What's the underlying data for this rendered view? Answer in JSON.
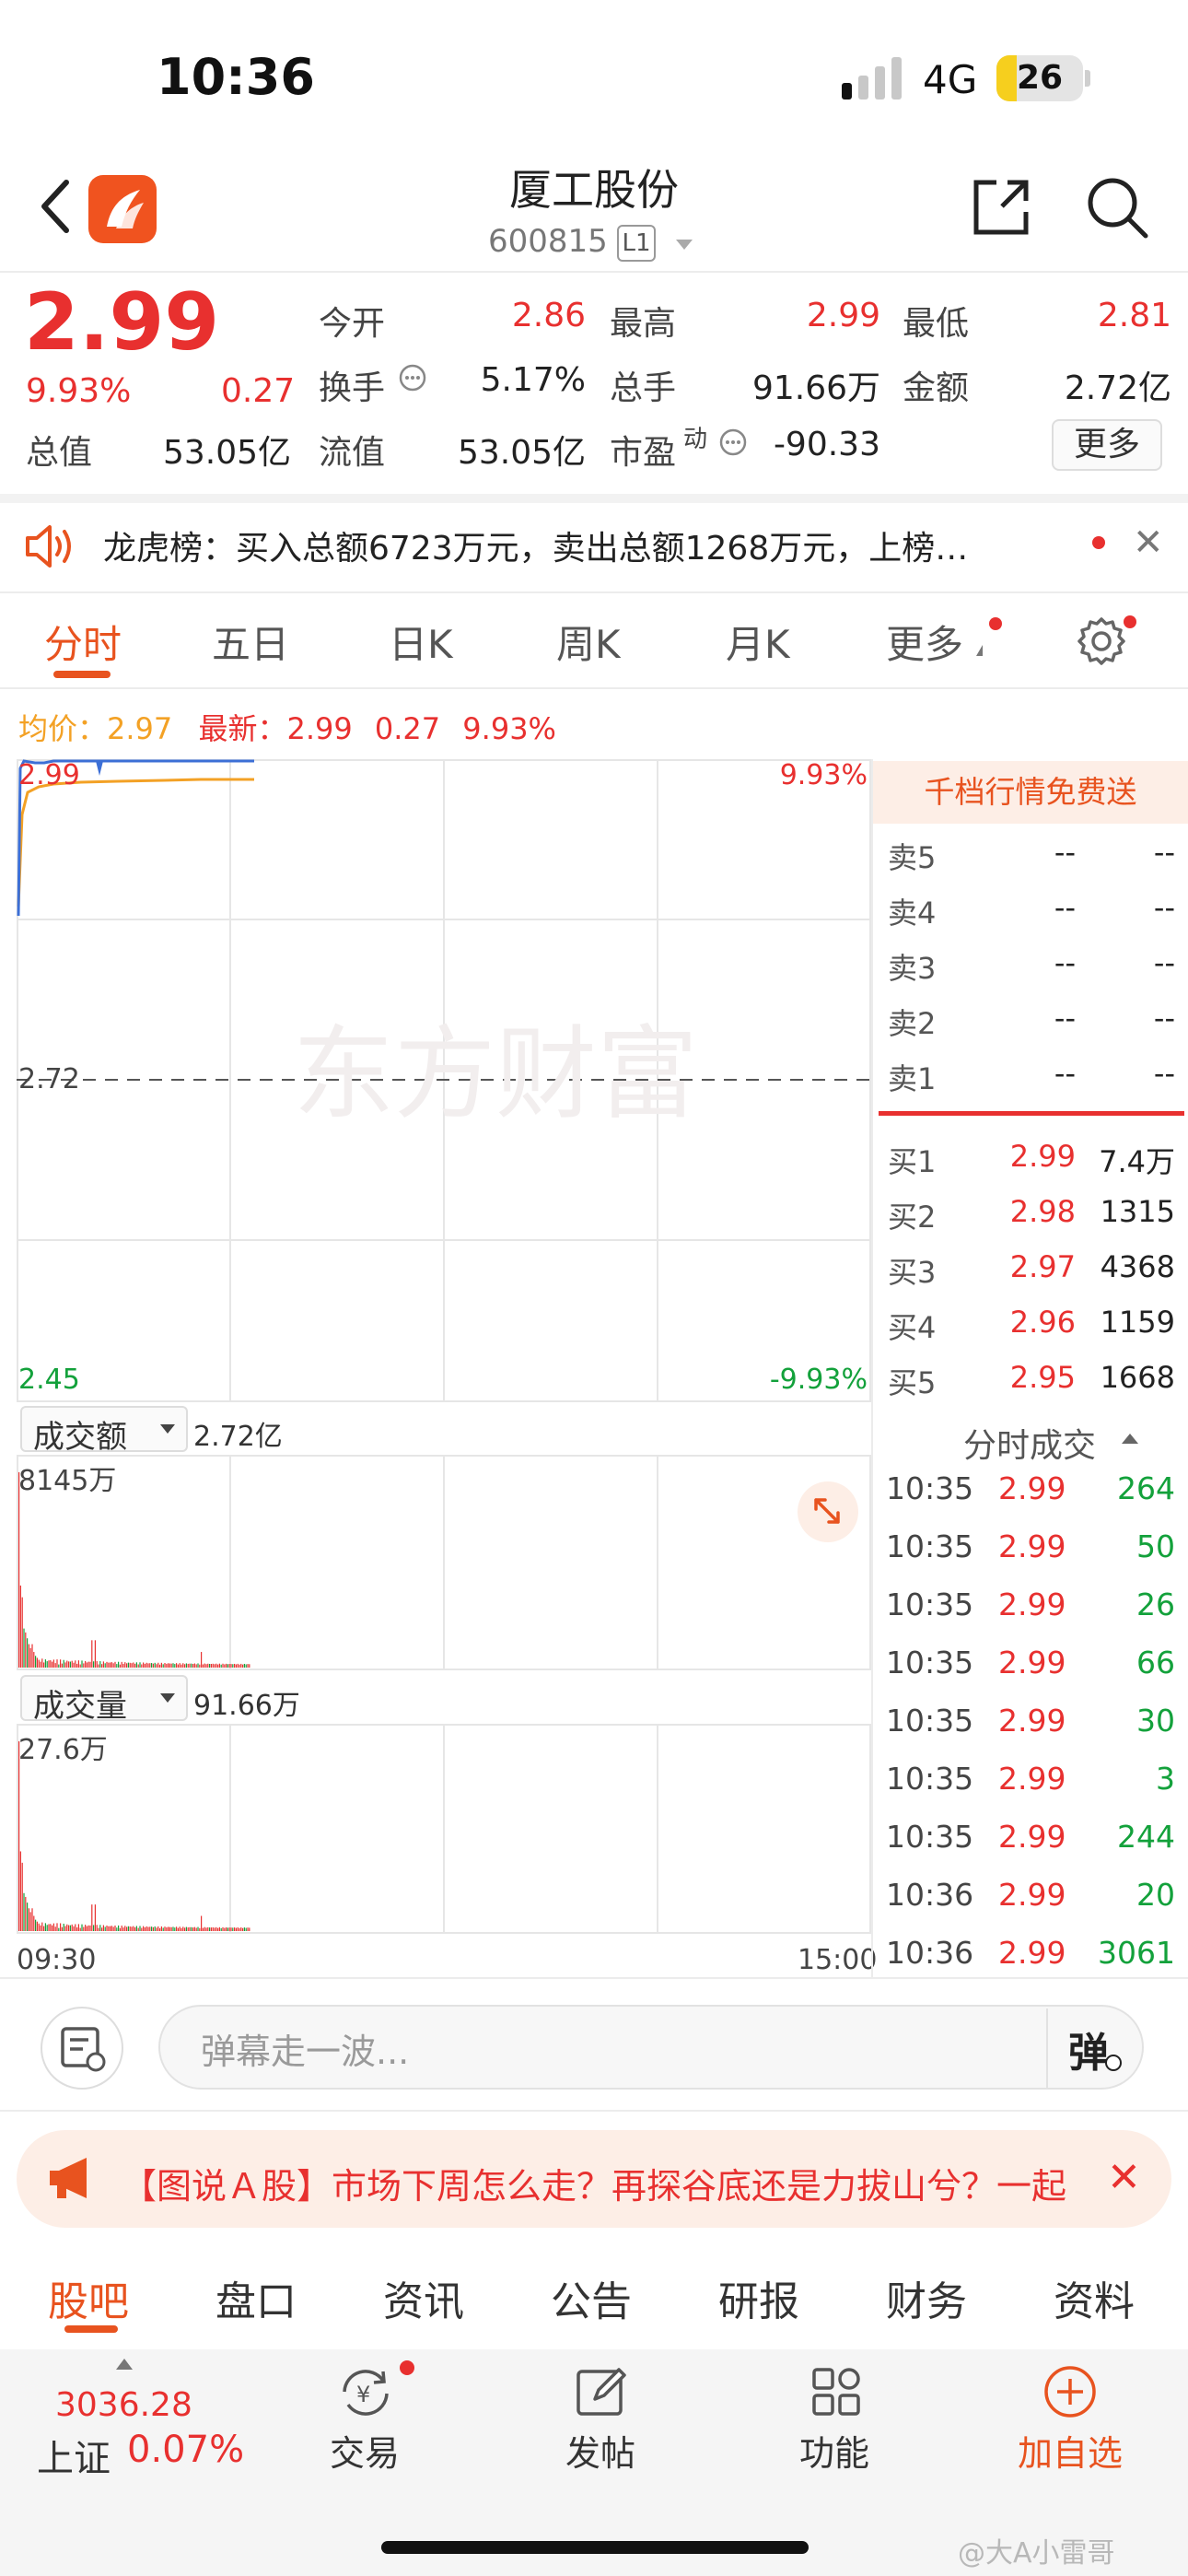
{
  "status_bar": {
    "time": "10:36",
    "network": "4G",
    "battery": "26"
  },
  "header": {
    "name": "厦工股份",
    "code": "600815",
    "level": "L1"
  },
  "quote": {
    "price": "2.99",
    "change_pct": "9.93%",
    "change": "0.27",
    "fields": [
      {
        "label": "今开",
        "value": "2.86"
      },
      {
        "label": "最高",
        "value": "2.99"
      },
      {
        "label": "最低",
        "value": "2.81"
      },
      {
        "label": "换手",
        "value": "5.17%"
      },
      {
        "label": "总手",
        "value": "91.66万"
      },
      {
        "label": "金额",
        "value": "2.72亿"
      },
      {
        "label": "总值",
        "value": "53.05亿"
      },
      {
        "label": "流值",
        "value": "53.05亿"
      },
      {
        "label": "市盈",
        "sup": "动",
        "value": "-90.33"
      }
    ],
    "more_label": "更多"
  },
  "notice": {
    "text": "龙虎榜：买入总额6723万元，卖出总额1268万元，上榜…"
  },
  "chart_tabs": [
    "分时",
    "五日",
    "日K",
    "周K",
    "月K",
    "更多"
  ],
  "avg_header": {
    "avg_label": "均价：",
    "avg_value": "2.97",
    "latest_label": "最新：",
    "latest_value": "2.99",
    "change": "0.27",
    "pct": "9.93%"
  },
  "chart_data": {
    "type": "line",
    "title": "",
    "price_axis": {
      "top": "2.99",
      "mid": "2.72",
      "bottom": "2.45",
      "top_pct": "9.93%",
      "bottom_pct": "-9.93%",
      "ylim": [
        2.45,
        2.99
      ]
    },
    "time_axis": {
      "start": "09:30",
      "end": "15:00"
    },
    "series": [],
    "turnover": {
      "label": "成交额",
      "total": "2.72亿",
      "max_label": "8145万"
    },
    "volume": {
      "label": "成交量",
      "total": "91.66万",
      "max_label": "27.6万"
    },
    "watermark": "东方财富"
  },
  "order_book": {
    "promo": "千档行情免费送",
    "sells": [
      {
        "label": "卖5",
        "price": "--",
        "vol": "--"
      },
      {
        "label": "卖4",
        "price": "--",
        "vol": "--"
      },
      {
        "label": "卖3",
        "price": "--",
        "vol": "--"
      },
      {
        "label": "卖2",
        "price": "--",
        "vol": "--"
      },
      {
        "label": "卖1",
        "price": "--",
        "vol": "--"
      }
    ],
    "buys": [
      {
        "label": "买1",
        "price": "2.99",
        "vol": "7.4万"
      },
      {
        "label": "买2",
        "price": "2.98",
        "vol": "1315"
      },
      {
        "label": "买3",
        "price": "2.97",
        "vol": "4368"
      },
      {
        "label": "买4",
        "price": "2.96",
        "vol": "1159"
      },
      {
        "label": "买5",
        "price": "2.95",
        "vol": "1668"
      }
    ]
  },
  "ticks": {
    "title": "分时成交",
    "rows": [
      {
        "time": "10:35",
        "price": "2.99",
        "vol": "264"
      },
      {
        "time": "10:35",
        "price": "2.99",
        "vol": "50"
      },
      {
        "time": "10:35",
        "price": "2.99",
        "vol": "26"
      },
      {
        "time": "10:35",
        "price": "2.99",
        "vol": "66"
      },
      {
        "time": "10:35",
        "price": "2.99",
        "vol": "30"
      },
      {
        "time": "10:35",
        "price": "2.99",
        "vol": "3"
      },
      {
        "time": "10:35",
        "price": "2.99",
        "vol": "244"
      },
      {
        "time": "10:36",
        "price": "2.99",
        "vol": "20"
      },
      {
        "time": "10:36",
        "price": "2.99",
        "vol": "3061"
      }
    ]
  },
  "comment_bar": {
    "placeholder": "弹幕走一波...",
    "button": "弹"
  },
  "news": {
    "text": "【图说Ａ股】市场下周怎么走？再探谷底还是力拔山兮？一起"
  },
  "bottom_tabs": [
    "股吧",
    "盘口",
    "资讯",
    "公告",
    "研报",
    "财务",
    "资料"
  ],
  "nav": {
    "index_value": "3036.28",
    "index_name": "上证",
    "index_change": "0.07%",
    "items": [
      "交易",
      "发帖",
      "功能",
      "加自选"
    ]
  },
  "watermark_text": "@大A小雷哥",
  "colors": {
    "up": "#e8302f",
    "down": "#13a13b",
    "accent": "#e8531f",
    "price_line": "#3c6fd6",
    "avg_line": "#f3a125"
  }
}
